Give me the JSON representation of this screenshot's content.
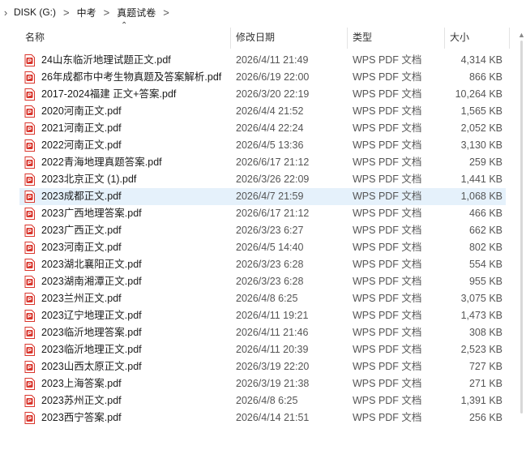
{
  "breadcrumb": {
    "items": [
      "DISK (G:)",
      "中考",
      "真题试卷"
    ],
    "separator": ">"
  },
  "columns": {
    "name": "名称",
    "date": "修改日期",
    "type": "类型",
    "size": "大小"
  },
  "icon_color": "#d9342b",
  "selected_row_color": "#e5f1fb",
  "files": [
    {
      "name": "24山东临沂地理试题正文.pdf",
      "date": "2026/4/11 21:49",
      "type": "WPS PDF 文档",
      "size": "4,314 KB"
    },
    {
      "name": "26年成都市中考生物真题及答案解析.pdf",
      "date": "2026/6/19 22:00",
      "type": "WPS PDF 文档",
      "size": "866 KB"
    },
    {
      "name": "2017-2024福建 正文+答案.pdf",
      "date": "2026/3/20 22:19",
      "type": "WPS PDF 文档",
      "size": "10,264 KB"
    },
    {
      "name": "2020河南正文.pdf",
      "date": "2026/4/4 21:52",
      "type": "WPS PDF 文档",
      "size": "1,565 KB"
    },
    {
      "name": "2021河南正文.pdf",
      "date": "2026/4/4 22:24",
      "type": "WPS PDF 文档",
      "size": "2,052 KB"
    },
    {
      "name": "2022河南正文.pdf",
      "date": "2026/4/5 13:36",
      "type": "WPS PDF 文档",
      "size": "3,130 KB"
    },
    {
      "name": "2022青海地理真题答案.pdf",
      "date": "2026/6/17 21:12",
      "type": "WPS PDF 文档",
      "size": "259 KB"
    },
    {
      "name": "2023北京正文 (1).pdf",
      "date": "2026/3/26 22:09",
      "type": "WPS PDF 文档",
      "size": "1,441 KB"
    },
    {
      "name": "2023成都正文.pdf",
      "date": "2026/4/7 21:59",
      "type": "WPS PDF 文档",
      "size": "1,068 KB"
    },
    {
      "name": "2023广西地理答案.pdf",
      "date": "2026/6/17 21:12",
      "type": "WPS PDF 文档",
      "size": "466 KB"
    },
    {
      "name": "2023广西正文.pdf",
      "date": "2026/3/23 6:27",
      "type": "WPS PDF 文档",
      "size": "662 KB"
    },
    {
      "name": "2023河南正文.pdf",
      "date": "2026/4/5 14:40",
      "type": "WPS PDF 文档",
      "size": "802 KB"
    },
    {
      "name": "2023湖北襄阳正文.pdf",
      "date": "2026/3/23 6:28",
      "type": "WPS PDF 文档",
      "size": "554 KB"
    },
    {
      "name": "2023湖南湘潭正文.pdf",
      "date": "2026/3/23 6:28",
      "type": "WPS PDF 文档",
      "size": "955 KB"
    },
    {
      "name": "2023兰州正文.pdf",
      "date": "2026/4/8 6:25",
      "type": "WPS PDF 文档",
      "size": "3,075 KB"
    },
    {
      "name": "2023辽宁地理正文.pdf",
      "date": "2026/4/11 19:21",
      "type": "WPS PDF 文档",
      "size": "1,473 KB"
    },
    {
      "name": "2023临沂地理答案.pdf",
      "date": "2026/4/11 21:46",
      "type": "WPS PDF 文档",
      "size": "308 KB"
    },
    {
      "name": "2023临沂地理正文.pdf",
      "date": "2026/4/11 20:39",
      "type": "WPS PDF 文档",
      "size": "2,523 KB"
    },
    {
      "name": "2023山西太原正文.pdf",
      "date": "2026/3/19 22:20",
      "type": "WPS PDF 文档",
      "size": "727 KB"
    },
    {
      "name": "2023上海答案.pdf",
      "date": "2026/3/19 21:38",
      "type": "WPS PDF 文档",
      "size": "271 KB"
    },
    {
      "name": "2023苏州正文.pdf",
      "date": "2026/4/8 6:25",
      "type": "WPS PDF 文档",
      "size": "1,391 KB"
    },
    {
      "name": "2023西宁答案.pdf",
      "date": "2026/4/14 21:51",
      "type": "WPS PDF 文档",
      "size": "256 KB"
    }
  ],
  "selected_index": 8
}
